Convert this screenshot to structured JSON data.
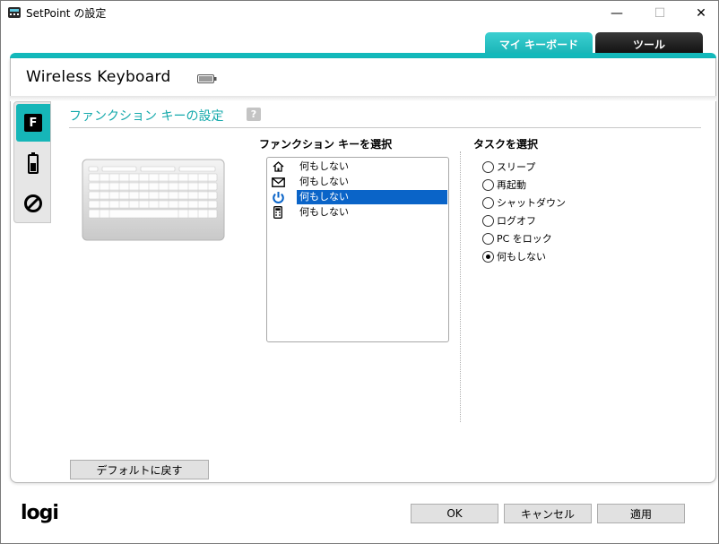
{
  "window": {
    "title": "SetPoint の設定",
    "minimize_glyph": "—",
    "maximize_glyph": "☐",
    "close_glyph": "✕"
  },
  "top_tabs": [
    {
      "label": "マイ キーボード",
      "active": true
    },
    {
      "label": "ツール",
      "active": false
    }
  ],
  "device": {
    "name": "Wireless Keyboard",
    "battery_icon": "battery-icon"
  },
  "side_tabs": [
    {
      "icon": "function-key-icon",
      "glyph": "F",
      "active": true
    },
    {
      "icon": "battery-status-icon",
      "active": false
    },
    {
      "icon": "disable-keys-icon",
      "active": false
    }
  ],
  "section": {
    "title": "ファンクション キーの設定",
    "help_glyph": "?"
  },
  "function_keys": {
    "label": "ファンクション キーを選択",
    "items": [
      {
        "icon": "home-icon",
        "label": "何もしない",
        "selected": false
      },
      {
        "icon": "mail-icon",
        "label": "何もしない",
        "selected": false
      },
      {
        "icon": "power-icon",
        "label": "何もしない",
        "selected": true
      },
      {
        "icon": "calculator-icon",
        "label": "何もしない",
        "selected": false
      }
    ]
  },
  "tasks": {
    "label": "タスクを選択",
    "options": [
      {
        "label": "スリープ",
        "checked": false
      },
      {
        "label": "再起動",
        "checked": false
      },
      {
        "label": "シャットダウン",
        "checked": false
      },
      {
        "label": "ログオフ",
        "checked": false
      },
      {
        "label": "PC をロック",
        "checked": false
      },
      {
        "label": "何もしない",
        "checked": true
      }
    ]
  },
  "buttons": {
    "restore_default": "デフォルトに戻す",
    "ok": "OK",
    "cancel": "キャンセル",
    "apply": "適用"
  },
  "logo": "logi",
  "colors": {
    "accent": "#16b6b8",
    "selection": "#0a64c8",
    "inactive_tab": "#1a1a1a"
  }
}
